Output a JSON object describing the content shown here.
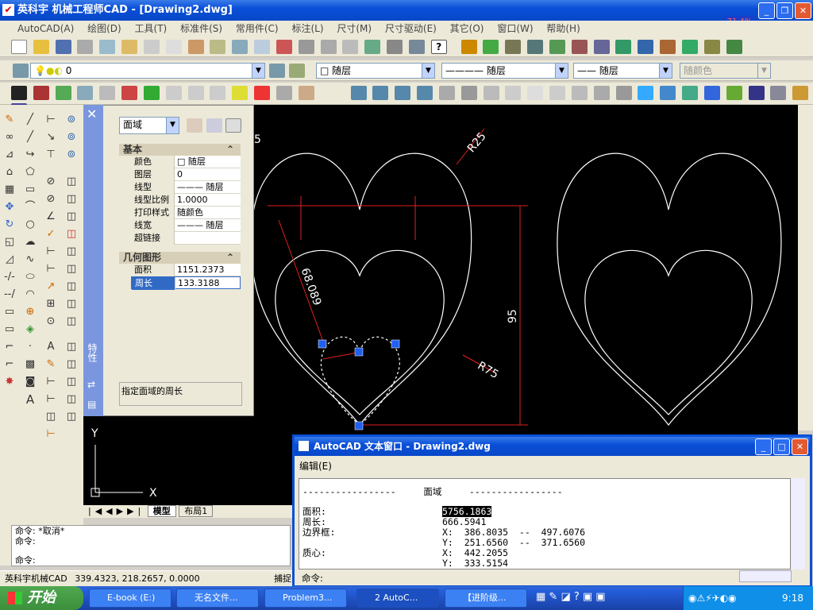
{
  "app": {
    "title": "英科宇 机械工程师CAD - [Drawing2.dwg]",
    "zoom_badge": "71.4%"
  },
  "menu": [
    "AutoCAD(A)",
    "绘图(D)",
    "工具(T)",
    "标准件(S)",
    "常用件(C)",
    "标注(L)",
    "尺寸(M)",
    "尺寸驱动(E)",
    "其它(O)",
    "窗口(W)",
    "帮助(H)"
  ],
  "layers": {
    "current_layer": "0",
    "color": "随层",
    "linetype": "随层",
    "lineweight": "随层",
    "plotstyle": "随颜色"
  },
  "properties": {
    "object_type": "面域",
    "section_basic": "基本",
    "section_geometry": "几何图形",
    "basic_rows": [
      {
        "k": "颜色",
        "v": "□ 随层"
      },
      {
        "k": "图层",
        "v": "0"
      },
      {
        "k": "线型",
        "v": "——— 随层"
      },
      {
        "k": "线型比例",
        "v": "1.0000"
      },
      {
        "k": "打印样式",
        "v": "随颜色"
      },
      {
        "k": "线宽",
        "v": "——— 随层"
      },
      {
        "k": "超链接",
        "v": ""
      }
    ],
    "geometry_rows": [
      {
        "k": "面积",
        "v": "1151.2373"
      },
      {
        "k": "周长",
        "v": "133.3188"
      }
    ],
    "description": "指定面域的周长",
    "strip_label": "特性"
  },
  "drawing": {
    "dims": {
      "r25": "R25",
      "r75": "R75",
      "d95": "95",
      "d68": "68.089",
      "r_partial": "5"
    },
    "ucs_x": "X",
    "ucs_y": "Y",
    "tabs": {
      "model": "模型",
      "layout": "布局1"
    }
  },
  "text_window": {
    "title": "AutoCAD 文本窗口 - Drawing2.dwg",
    "menu": "编辑(E)",
    "header": "-----------------     面域     -----------------",
    "lines": [
      {
        "label": "面积:",
        "value": "5756.1863"
      },
      {
        "label": "周长:",
        "value": "666.5941"
      },
      {
        "label": "边界框:",
        "value": "X:  386.8035  --  497.6076"
      },
      {
        "label": "",
        "value": "Y:  251.6560  --  371.6560"
      },
      {
        "label": "质心:",
        "value": "X:  442.2055"
      },
      {
        "label": "",
        "value": "Y:  333.5154"
      }
    ],
    "prompt": "命令:"
  },
  "command": {
    "lines": [
      "命令: *取消*",
      "命令:",
      "命令:"
    ]
  },
  "status": {
    "app_label": "英科宇机械CAD",
    "coords": "339.4323, 218.2657, 0.0000",
    "snap": "捕捉"
  },
  "taskbar": {
    "start": "开始",
    "tasks": [
      "E-book (E:)",
      "无名文件...",
      "Problem3...",
      "2 AutoC...",
      "【进阶级..."
    ],
    "clock": "9:18"
  }
}
